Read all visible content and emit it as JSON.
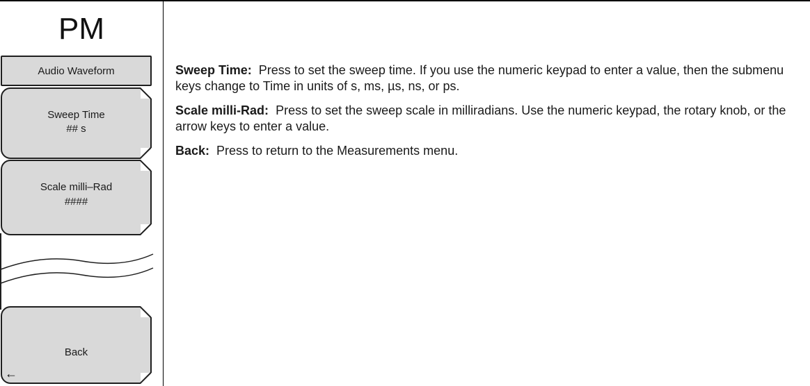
{
  "menu": {
    "title": "PM",
    "header_label": "Audio Waveform",
    "sweep_time": {
      "label": "Sweep Time",
      "value": "## s"
    },
    "scale": {
      "label": "Scale milli–Rad",
      "value": "####"
    },
    "back": {
      "label": "Back",
      "arrow": "←"
    }
  },
  "descriptions": [
    {
      "term": "Sweep Time:",
      "text": "Press to set the sweep time. If you use the numeric keypad to enter a value, then the submenu keys change to Time in units of s, ms, µs, ns, or ps."
    },
    {
      "term": "Scale milli-Rad:",
      "text": "Press to set the sweep scale in milliradians. Use the numeric keypad, the rotary knob, or the arrow keys to enter a value."
    },
    {
      "term": "Back:",
      "text": "Press to return to the Measurements menu."
    }
  ]
}
